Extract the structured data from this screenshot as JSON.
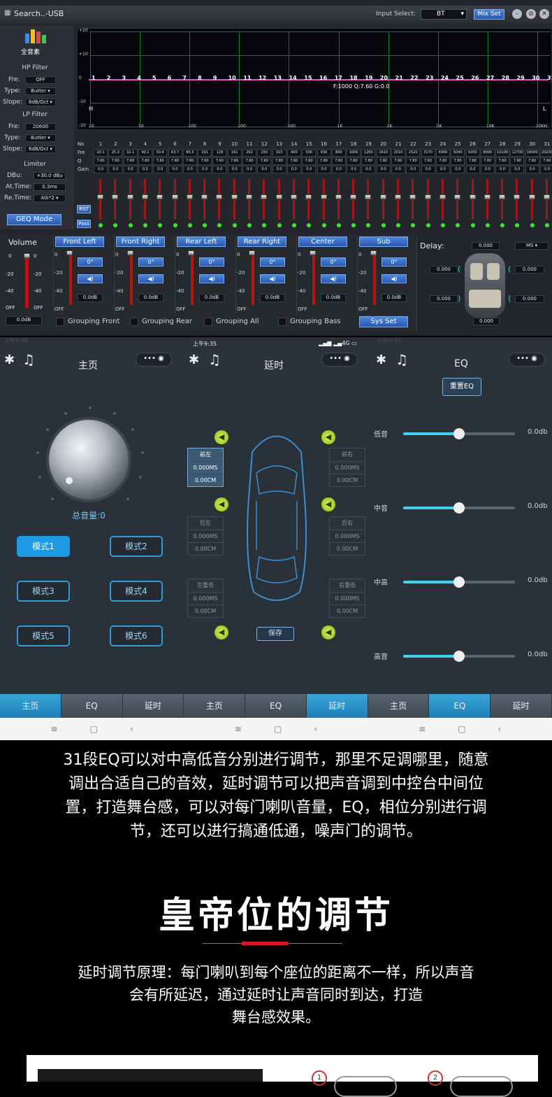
{
  "pc": {
    "title": "Search..-USB",
    "input_select_label": "Input Select:",
    "input_select_value": "BT",
    "mix_set": "Mix Set",
    "logo_text": "全音素",
    "hp_filter": {
      "header": "HP Filter",
      "fre_label": "Fre:",
      "fre": "OFF",
      "type_label": "Type:",
      "type": "Butter",
      "slope_label": "Slope:",
      "slope": "6dB/Oct"
    },
    "lp_filter": {
      "header": "LP Filter",
      "fre_label": "Fre:",
      "fre": "20600",
      "type_label": "Type:",
      "type": "Butter",
      "slope_label": "Slope:",
      "slope": "6dB/Oct"
    },
    "limiter": {
      "header": "Limiter",
      "dbu_label": "DBu:",
      "dbu": "+30.0 dBu",
      "at_label": "At.Time:",
      "at": "0.3ms",
      "re_label": "Re.Time:",
      "re": "Atk*2"
    },
    "geq_mode": "GEQ Mode",
    "graph": {
      "y_labels": [
        "+20",
        "+10",
        "0",
        "-10",
        "-20"
      ],
      "x_labels": [
        "20",
        "50",
        "100",
        "200",
        "500",
        "1K",
        "2K",
        "5K",
        "10K",
        "20KH"
      ],
      "band_numbers": [
        "1",
        "2",
        "3",
        "4",
        "5",
        "6",
        "7",
        "8",
        "9",
        "10",
        "11",
        "12",
        "13",
        "14",
        "15",
        "16",
        "17",
        "18",
        "19",
        "20",
        "21",
        "22",
        "23",
        "24",
        "25",
        "26",
        "27",
        "28",
        "29",
        "30",
        "31"
      ],
      "readout": "F:1000 Q:7.60 G:0.0",
      "h_marker": "H",
      "l_marker": "L"
    },
    "eq_table": {
      "row_labels": [
        "No",
        "Fre",
        "Q",
        "Gain"
      ],
      "fre": [
        "20.1",
        "25.3",
        "32.1",
        "40.1",
        "50.4",
        "63.7",
        "80.3",
        "101",
        "128",
        "161",
        "202",
        "250",
        "315",
        "400",
        "500",
        "630",
        "800",
        "1000",
        "1260",
        "1610",
        "2010",
        "2520",
        "3170",
        "4000",
        "5040",
        "6350",
        "8000",
        "10100",
        "12700",
        "16000",
        "20200"
      ],
      "q": "7.60",
      "gain": "0.0"
    },
    "rst": "RST",
    "pass": "Pass",
    "volume": {
      "label": "Volume",
      "value": "0.0dB",
      "scale": [
        "0",
        "-20",
        "-40",
        "OFF"
      ]
    },
    "channels": [
      {
        "name": "Front Left",
        "phase": "0°",
        "gain": "0.0dB"
      },
      {
        "name": "Front Right",
        "phase": "0°",
        "gain": "0.0dB"
      },
      {
        "name": "Rear Left",
        "phase": "0°",
        "gain": "0.0dB"
      },
      {
        "name": "Rear Right",
        "phase": "0°",
        "gain": "0.0dB"
      },
      {
        "name": "Center",
        "phase": "0°",
        "gain": "0.0dB"
      },
      {
        "name": "Sub",
        "phase": "0°",
        "gain": "0.0dB"
      }
    ],
    "channel_scale": [
      "0",
      "-20",
      "-40",
      "OFF"
    ],
    "grouping": [
      "Grouping Front",
      "Grouping Rear",
      "Grouping All",
      "Grouping Bass"
    ],
    "sys_set": "Sys Set",
    "delay": {
      "label": "Delay:",
      "unit": "MS",
      "values": [
        "0.000",
        "0.000",
        "0.000",
        "0.000",
        "0.000",
        "0.000"
      ]
    }
  },
  "phones": {
    "status_time": "上午9:35",
    "status_net": "4G",
    "home": {
      "title": "主页",
      "pill": "•••",
      "volume_label": "总音量:0",
      "modes": [
        "模式1",
        "模式2",
        "模式3",
        "模式4",
        "模式5",
        "模式6"
      ]
    },
    "delay": {
      "title": "延时",
      "pill": "•••",
      "boxes": [
        {
          "name": "前左",
          "ms": "0.000MS",
          "cm": "0.00CM"
        },
        {
          "name": "前右",
          "ms": "0.000MS",
          "cm": "0.00CM"
        },
        {
          "name": "后左",
          "ms": "0.000MS",
          "cm": "0.00CM"
        },
        {
          "name": "后右",
          "ms": "0.000MS",
          "cm": "0.00CM"
        },
        {
          "name": "左重低",
          "ms": "0.000MS",
          "cm": "0.00CM"
        },
        {
          "name": "右重低",
          "ms": "0.000MS",
          "cm": "0.00CM"
        }
      ],
      "save": "保存"
    },
    "eq": {
      "title": "EQ",
      "pill": "•••",
      "reset": "重置EQ",
      "bands": [
        {
          "name": "低音",
          "value": "0.0db",
          "level": 0.5
        },
        {
          "name": "中音",
          "value": "0.0db",
          "level": 0.5
        },
        {
          "name": "中高",
          "value": "0.0db",
          "level": 0.5
        },
        {
          "name": "高音",
          "value": "0.0db",
          "level": 0.5
        }
      ]
    },
    "tabs": [
      "主页",
      "EQ",
      "延时",
      "主页",
      "EQ",
      "延时",
      "主页",
      "EQ",
      "延时"
    ]
  },
  "text": {
    "para1": [
      "31段EQ可以对中高低音分别进行调节，那里不足调哪里，随意",
      "调出合适自己的音效，延时调节可以把声音调到中控台中间位",
      "置，打造舞台感，可以对每门喇叭音量，EQ，相位分别进行调",
      "节，还可以进行搞通低通，噪声门的调节。"
    ],
    "heading": "皇帝位的调节",
    "para2": [
      "延时调节原理：每门喇叭到每个座位的距离不一样，所以声音",
      "会有所延迟，通过延时让声音同时到达，打造",
      "舞台感效果。"
    ],
    "badges": [
      "1",
      "2"
    ]
  },
  "colors": {
    "accent": "#1c9ae4",
    "graph_grid": "#0d7d25",
    "curve": "#e04fd4",
    "fader_red": "#a01818"
  }
}
